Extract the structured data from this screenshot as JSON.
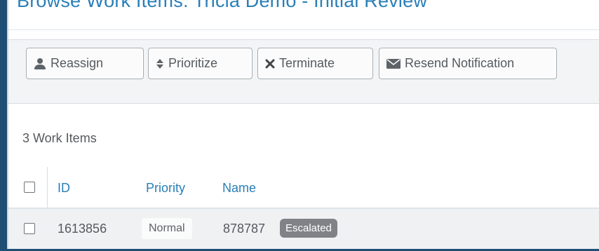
{
  "header": {
    "title": "Browse Work Items: Tricia Demo - Initial Review"
  },
  "toolbar": {
    "buttons": [
      {
        "label": "Reassign",
        "icon": "user-icon"
      },
      {
        "label": "Prioritize",
        "icon": "sort-icon"
      },
      {
        "label": "Terminate",
        "icon": "close-icon"
      },
      {
        "label": "Resend Notification",
        "icon": "envelope-icon"
      }
    ]
  },
  "list": {
    "count_label": "3 Work Items",
    "columns": [
      "ID",
      "Priority",
      "Name"
    ],
    "rows": [
      {
        "id": "1613856",
        "priority": "Normal",
        "name": "878787",
        "status": "Escalated"
      }
    ]
  },
  "colors": {
    "accent": "#2a7fb8",
    "badge": "#7f8387",
    "frame": "#1e4e73"
  }
}
